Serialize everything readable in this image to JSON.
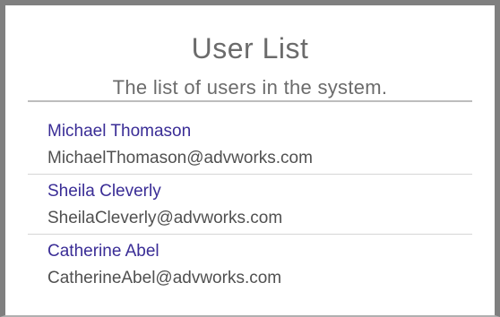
{
  "header": {
    "title": "User List",
    "subtitle": "The list of users in the system."
  },
  "users": [
    {
      "name": "Michael Thomason",
      "email": "MichaelThomason@advworks.com"
    },
    {
      "name": "Sheila Cleverly",
      "email": "SheilaCleverly@advworks.com"
    },
    {
      "name": "Catherine Abel",
      "email": "CatherineAbel@advworks.com"
    }
  ]
}
